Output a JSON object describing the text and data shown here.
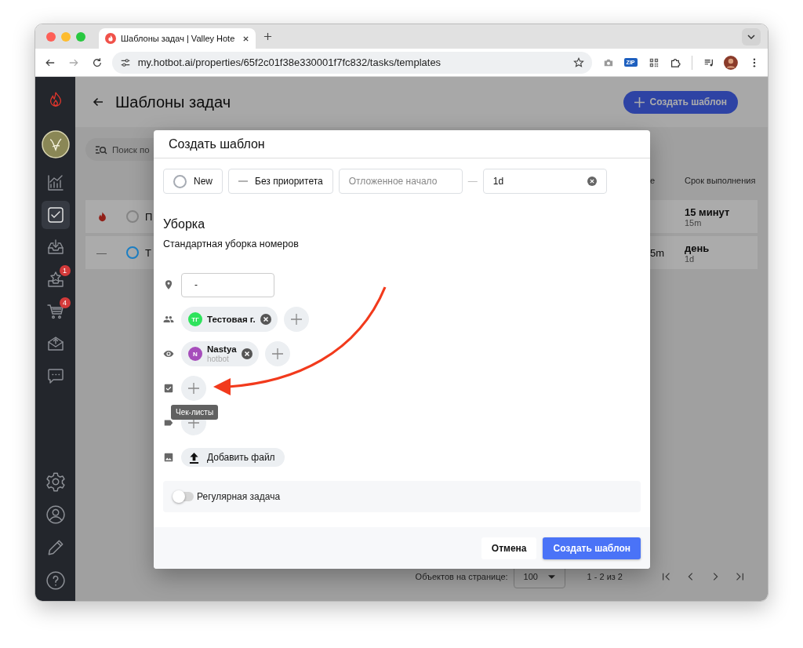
{
  "browser": {
    "tab_title": "Шаблоны задач | Valley Hote",
    "url": "my.hotbot.ai/properties/65f2c01f38e330001f7fc832/tasks/templates",
    "extension_badge": "ZIP"
  },
  "sidebar": {
    "top": [
      {
        "kind": "chart",
        "selected": false
      },
      {
        "kind": "tasks",
        "selected": true
      },
      {
        "kind": "inbox",
        "selected": false
      },
      {
        "kind": "reviews",
        "selected": false,
        "badge": "1"
      },
      {
        "kind": "cart",
        "selected": false,
        "badge": "4"
      },
      {
        "kind": "mail",
        "selected": false
      },
      {
        "kind": "chat",
        "selected": false
      }
    ],
    "bottom": [
      {
        "kind": "settings",
        "selected": false
      },
      {
        "kind": "profile",
        "selected": false
      },
      {
        "kind": "edit",
        "selected": false
      },
      {
        "kind": "help",
        "selected": false
      }
    ]
  },
  "page": {
    "title": "Шаблоны задач",
    "create_button": "Создать шаблон",
    "search_placeholder": "Поиск по",
    "columns": [
      "е",
      "Срок выполнения"
    ],
    "rows": [
      {
        "kind": "urgent",
        "color": "#858585",
        "column_3": "П",
        "due": "15 минут",
        "due_short": "15m"
      },
      {
        "kind": "none",
        "priority": "—",
        "color": "#1c7fc4",
        "column_3": "Т",
        "column_4": "5m",
        "due": "день",
        "due_short": "1d"
      }
    ],
    "pagination": {
      "label": "Объектов на странице:",
      "per_page": "100",
      "range": "1 - 2 из 2"
    }
  },
  "modal": {
    "title": "Создать шаблон",
    "status": "New",
    "priority": "Без приоритета",
    "start_placeholder": "Отложенное начало",
    "separator": "—",
    "duration": "1d",
    "task_title": "Уборка",
    "description": "Стандартная уборка номеров",
    "location": "-",
    "assignees": [
      {
        "initials": "ТГ",
        "name": "Тестовая г.",
        "color": "#2ee35c"
      }
    ],
    "watchers": [
      {
        "initials": "N",
        "name": "Nastya",
        "subtitle": "hotbot",
        "color": "#a64dbb"
      }
    ],
    "checklist_tooltip": "Чек-листы",
    "file_button": "Добавить файл",
    "recurring": {
      "label": "Регулярная задача",
      "on": false
    },
    "cancel": "Отмена",
    "submit": "Создать шаблон"
  }
}
